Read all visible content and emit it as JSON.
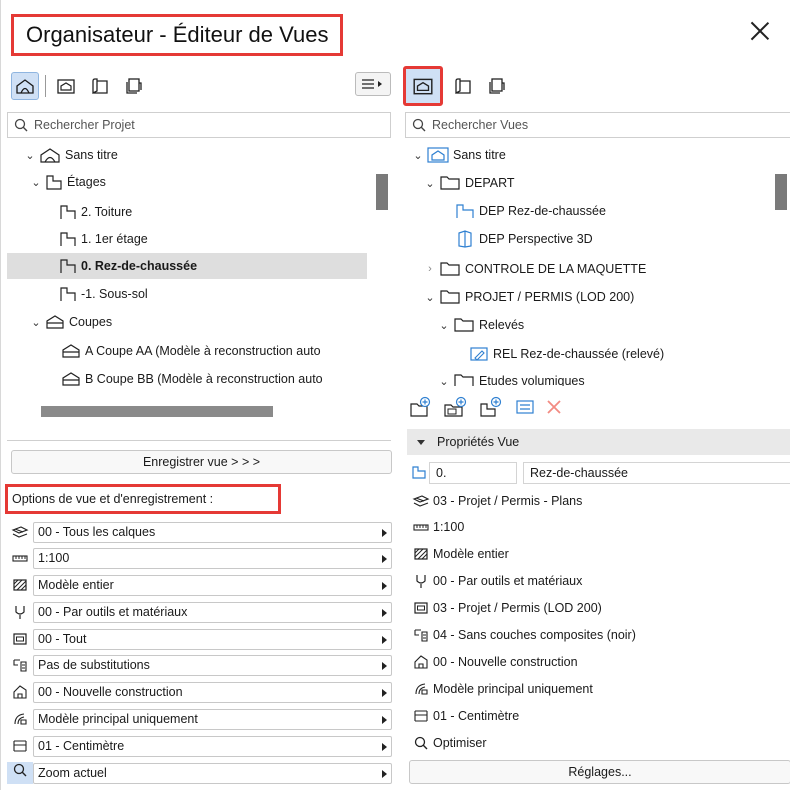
{
  "window": {
    "title": "Organisateur - Éditeur de Vues"
  },
  "left": {
    "search_placeholder": "Rechercher Projet",
    "tree": [
      {
        "label": "Sans titre",
        "icon": "house-icon",
        "chev": "down"
      },
      {
        "label": "Étages",
        "icon": "story-icon",
        "chev": "down"
      },
      {
        "label": "2. Toiture",
        "icon": "story-icon",
        "chev": ""
      },
      {
        "label": "1. 1er étage",
        "icon": "story-icon",
        "chev": ""
      },
      {
        "label": "0. Rez-de-chaussée",
        "icon": "story-icon",
        "chev": "",
        "selected": true
      },
      {
        "label": "-1. Sous-sol",
        "icon": "story-icon",
        "chev": ""
      },
      {
        "label": "Coupes",
        "icon": "section-icon",
        "chev": "down"
      },
      {
        "label": "A Coupe AA (Modèle à reconstruction auto",
        "icon": "section-icon",
        "chev": ""
      },
      {
        "label": "B Coupe BB (Modèle à reconstruction auto",
        "icon": "section-icon",
        "chev": ""
      }
    ],
    "save_button": "Enregistrer vue > > >",
    "options_title": "Options de vue et d'enregistrement :",
    "options": [
      {
        "icon": "layers-icon",
        "value": "00 - Tous les calques"
      },
      {
        "icon": "scale-icon",
        "value": "1:100"
      },
      {
        "icon": "structure-icon",
        "value": "Modèle entier"
      },
      {
        "icon": "pen-icon",
        "value": "00 - Par outils et matériaux"
      },
      {
        "icon": "model-view-icon",
        "value": "00 - Tout"
      },
      {
        "icon": "override-icon",
        "value": "Pas de substitutions"
      },
      {
        "icon": "renovation-icon",
        "value": "00 - Nouvelle construction"
      },
      {
        "icon": "partial-structure-icon",
        "value": "Modèle principal uniquement"
      },
      {
        "icon": "dimension-icon",
        "value": "01 - Centimètre"
      },
      {
        "icon": "zoom-icon",
        "value": "Zoom actuel"
      }
    ]
  },
  "right": {
    "search_placeholder": "Rechercher Vues",
    "tree": [
      {
        "label": "Sans titre",
        "icon": "house-icon",
        "chev": "down"
      },
      {
        "label": "DEPART",
        "icon": "folder-icon",
        "chev": "down"
      },
      {
        "label": "DEP Rez-de-chaussée",
        "icon": "story-icon",
        "chev": ""
      },
      {
        "label": "DEP Perspective 3D",
        "icon": "3d-icon",
        "chev": ""
      },
      {
        "label": "CONTROLE DE LA MAQUETTE",
        "icon": "folder-icon",
        "chev": "right"
      },
      {
        "label": "PROJET / PERMIS (LOD 200)",
        "icon": "folder-icon",
        "chev": "down"
      },
      {
        "label": "Relevés",
        "icon": "folder-icon",
        "chev": "down"
      },
      {
        "label": "REL Rez-de-chaussée (relevé)",
        "icon": "edit-view-icon",
        "chev": ""
      },
      {
        "label": "Etudes volumiques",
        "icon": "folder-icon",
        "chev": "down"
      }
    ],
    "props_title": "Propriétés Vue",
    "story_number": "0.",
    "story_name": "Rez-de-chaussée",
    "props": [
      {
        "icon": "layers-icon",
        "value": "03 - Projet / Permis - Plans"
      },
      {
        "icon": "scale-icon",
        "value": "1:100"
      },
      {
        "icon": "structure-icon",
        "value": "Modèle entier"
      },
      {
        "icon": "pen-icon",
        "value": "00 - Par outils et matériaux"
      },
      {
        "icon": "model-view-icon",
        "value": "03 - Projet / Permis (LOD 200)"
      },
      {
        "icon": "override-icon",
        "value": "04 - Sans couches composites (noir)"
      },
      {
        "icon": "renovation-icon",
        "value": "00 - Nouvelle construction"
      },
      {
        "icon": "partial-structure-icon",
        "value": "Modèle principal uniquement"
      },
      {
        "icon": "dimension-icon",
        "value": "01 - Centimètre"
      },
      {
        "icon": "zoom-icon",
        "value": "Optimiser"
      }
    ],
    "settings_button": "Réglages..."
  },
  "colors": {
    "highlight": "#e53935",
    "accent_blue": "#2f80d1",
    "selected_row": "#dedede"
  }
}
